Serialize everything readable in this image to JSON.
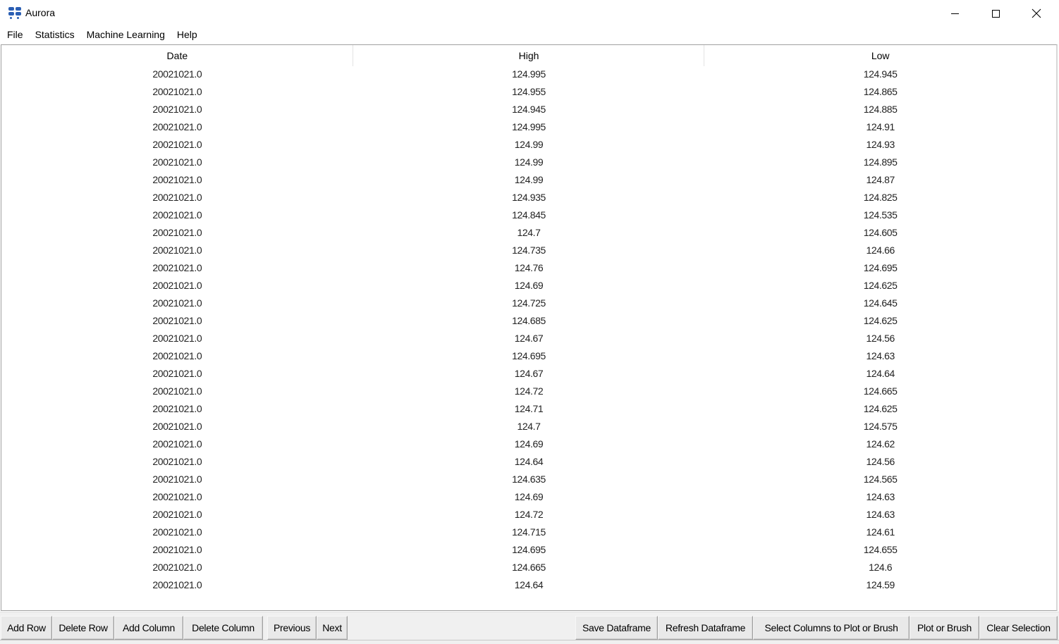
{
  "window": {
    "title": "Aurora",
    "icon": "aurora-app-icon",
    "controls": [
      "minimize",
      "maximize",
      "close"
    ]
  },
  "menubar": {
    "items": [
      {
        "label": "File"
      },
      {
        "label": "Statistics"
      },
      {
        "label": "Machine Learning"
      },
      {
        "label": "Help"
      }
    ]
  },
  "table": {
    "columns": [
      "Date",
      "High",
      "Low"
    ],
    "rows": [
      [
        "20021021.0",
        "124.995",
        "124.945"
      ],
      [
        "20021021.0",
        "124.955",
        "124.865"
      ],
      [
        "20021021.0",
        "124.945",
        "124.885"
      ],
      [
        "20021021.0",
        "124.995",
        "124.91"
      ],
      [
        "20021021.0",
        "124.99",
        "124.93"
      ],
      [
        "20021021.0",
        "124.99",
        "124.895"
      ],
      [
        "20021021.0",
        "124.99",
        "124.87"
      ],
      [
        "20021021.0",
        "124.935",
        "124.825"
      ],
      [
        "20021021.0",
        "124.845",
        "124.535"
      ],
      [
        "20021021.0",
        "124.7",
        "124.605"
      ],
      [
        "20021021.0",
        "124.735",
        "124.66"
      ],
      [
        "20021021.0",
        "124.76",
        "124.695"
      ],
      [
        "20021021.0",
        "124.69",
        "124.625"
      ],
      [
        "20021021.0",
        "124.725",
        "124.645"
      ],
      [
        "20021021.0",
        "124.685",
        "124.625"
      ],
      [
        "20021021.0",
        "124.67",
        "124.56"
      ],
      [
        "20021021.0",
        "124.695",
        "124.63"
      ],
      [
        "20021021.0",
        "124.67",
        "124.64"
      ],
      [
        "20021021.0",
        "124.72",
        "124.665"
      ],
      [
        "20021021.0",
        "124.71",
        "124.625"
      ],
      [
        "20021021.0",
        "124.7",
        "124.575"
      ],
      [
        "20021021.0",
        "124.69",
        "124.62"
      ],
      [
        "20021021.0",
        "124.64",
        "124.56"
      ],
      [
        "20021021.0",
        "124.635",
        "124.565"
      ],
      [
        "20021021.0",
        "124.69",
        "124.63"
      ],
      [
        "20021021.0",
        "124.72",
        "124.63"
      ],
      [
        "20021021.0",
        "124.715",
        "124.61"
      ],
      [
        "20021021.0",
        "124.695",
        "124.655"
      ],
      [
        "20021021.0",
        "124.665",
        "124.6"
      ],
      [
        "20021021.0",
        "124.64",
        "124.59"
      ]
    ]
  },
  "toolbar": {
    "add_row": "Add Row",
    "delete_row": "Delete Row",
    "add_column": "Add Column",
    "delete_column": "Delete Column",
    "previous": "Previous",
    "next": "Next",
    "save_dataframe": "Save Dataframe",
    "refresh_dataframe": "Refresh Dataframe",
    "select_columns": "Select Columns to Plot or Brush",
    "plot_or_brush": "Plot or Brush",
    "clear_selection": "Clear Selection"
  },
  "colors": {
    "app_icon": "#2b5fb4",
    "button_face": "#e9e9e9",
    "toolbar_bg": "#f0f0f0"
  }
}
